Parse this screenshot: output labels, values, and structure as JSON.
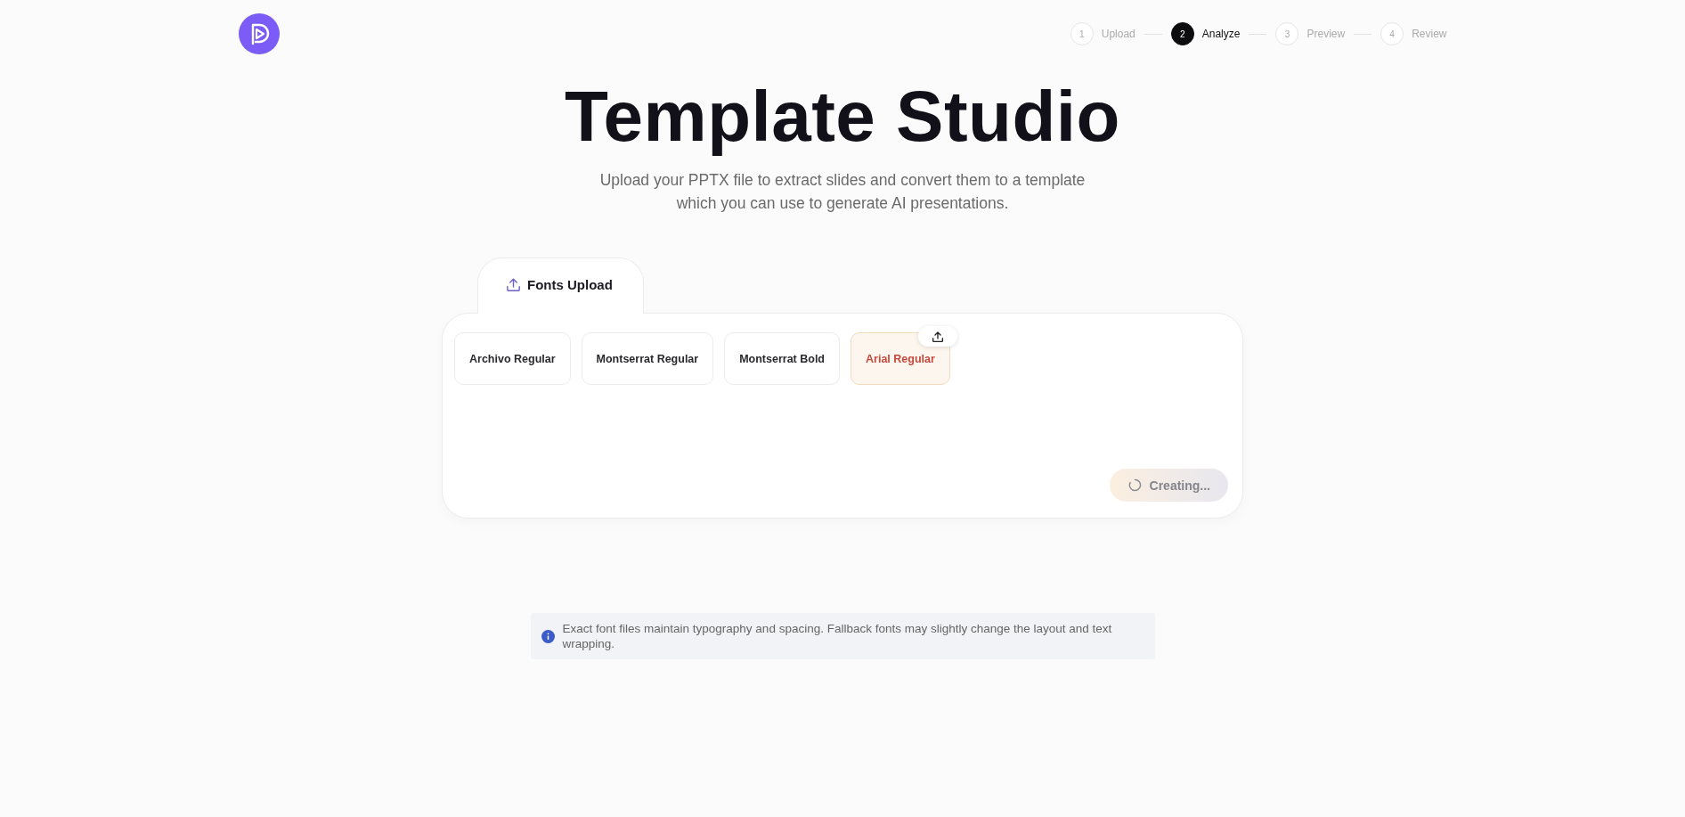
{
  "header": {
    "steps": [
      {
        "number": "1",
        "label": "Upload",
        "selected": false
      },
      {
        "number": "2",
        "label": "Analyze",
        "selected": true
      },
      {
        "number": "3",
        "label": "Preview",
        "selected": false
      },
      {
        "number": "4",
        "label": "Review",
        "selected": false
      }
    ]
  },
  "hero": {
    "title": "Template Studio",
    "subtitle": "Upload your PPTX file to extract slides and convert them to a template which you can use to generate AI presentations."
  },
  "tabs": [
    {
      "label": "Fonts Upload",
      "selected": true
    }
  ],
  "fonts": [
    {
      "name": "Archivo Regular",
      "missing": false
    },
    {
      "name": "Montserrat Regular",
      "missing": false
    },
    {
      "name": "Montserrat Bold",
      "missing": false
    },
    {
      "name": "Arial Regular",
      "missing": true
    }
  ],
  "create_button": {
    "label": "Creating...",
    "loading": true
  },
  "notice": {
    "text": "Exact font files maintain typography and spacing. Fallback fonts may slightly change the layout and text wrapping."
  }
}
